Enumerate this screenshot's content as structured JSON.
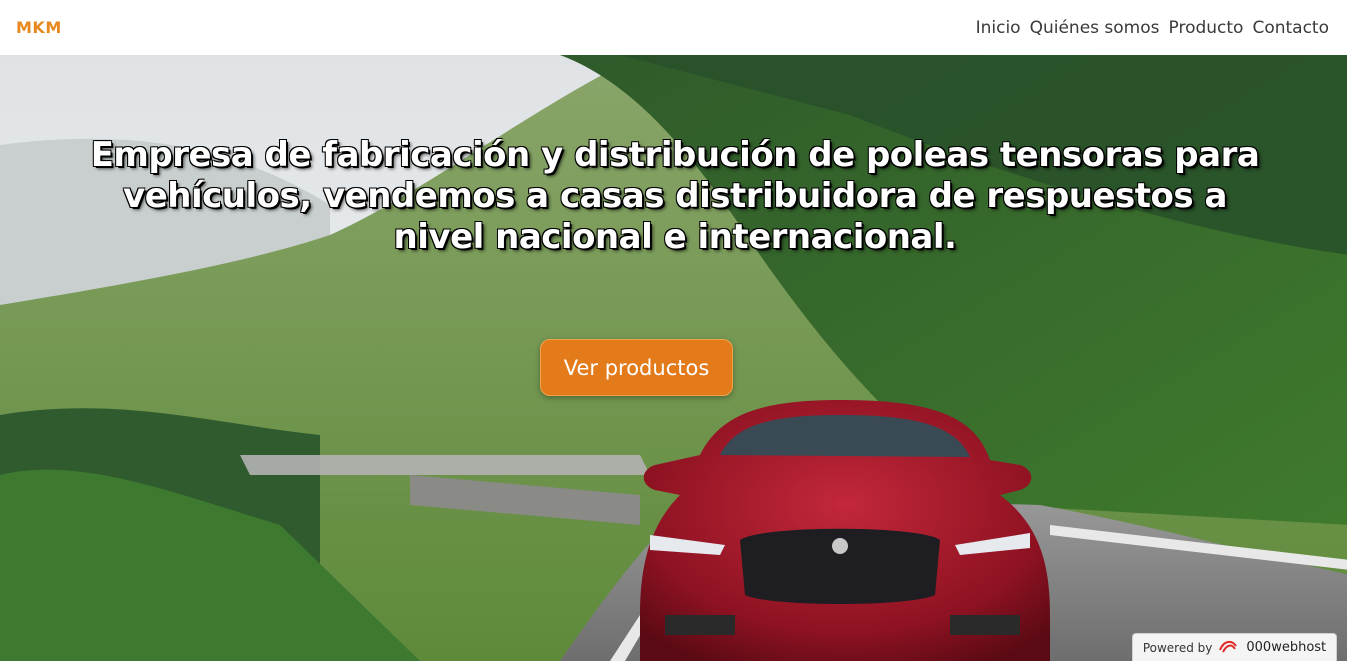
{
  "navbar": {
    "brand": "MKM",
    "links": [
      "Inicio",
      "Quiénes somos",
      "Producto",
      "Contacto"
    ]
  },
  "hero": {
    "headline": "Empresa de fabricación y distribución de poleas tensoras para vehículos, vendemos a casas distribuidora de respuestos a nivel nacional e internacional.",
    "cta_label": "Ver productos"
  },
  "footer_badge": {
    "prefix": "Powered by",
    "host": "000webhost"
  },
  "colors": {
    "accent": "#e47b1b",
    "brand": "#e8891f",
    "nav_text": "#3a3a3a"
  }
}
